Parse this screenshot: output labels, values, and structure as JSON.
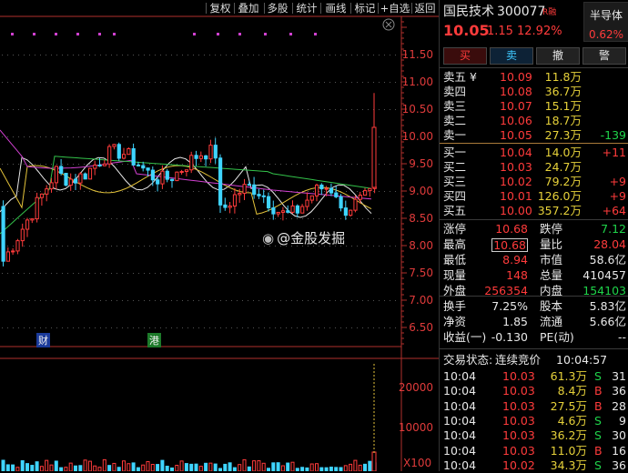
{
  "toolbar": {
    "buttons": [
      "复权",
      "叠加",
      "多股",
      "统计",
      "画线",
      "标记",
      "+自选",
      "返回"
    ]
  },
  "price_axis": [
    "11.50",
    "11.00",
    "10.50",
    "10.00",
    "9.50",
    "9.00",
    "8.50",
    "8.00",
    "7.50",
    "7.00",
    "6.50"
  ],
  "volume_axis": [
    "20000",
    "10000"
  ],
  "volume_unit": "X100",
  "markers": {
    "cai": "财",
    "gang": "港"
  },
  "watermark": "@金股发掘",
  "stock": {
    "name": "国民技术",
    "code": "300077",
    "tag": "R融",
    "sector": "半导体",
    "sector_change": "0.62%",
    "price": "10.05",
    "change": "1.15",
    "change_pct": "12.92%"
  },
  "actions": {
    "buy": "买",
    "sell": "卖",
    "cancel": "撤",
    "alert": "警"
  },
  "asks": [
    {
      "label": "卖五 ¥",
      "price": "10.09",
      "vol": "11.8万",
      "delta": ""
    },
    {
      "label": "卖四",
      "price": "10.08",
      "vol": "36.7万",
      "delta": ""
    },
    {
      "label": "卖三",
      "price": "10.07",
      "vol": "15.1万",
      "delta": ""
    },
    {
      "label": "卖二",
      "price": "10.06",
      "vol": "18.7万",
      "delta": ""
    },
    {
      "label": "卖一",
      "price": "10.05",
      "vol": "27.3万",
      "delta": "-139"
    }
  ],
  "bids": [
    {
      "label": "买一",
      "price": "10.04",
      "vol": "14.0万",
      "delta": "+11"
    },
    {
      "label": "买二",
      "price": "10.03",
      "vol": "24.7万",
      "delta": ""
    },
    {
      "label": "买三",
      "price": "10.02",
      "vol": "79.2万",
      "delta": "+9"
    },
    {
      "label": "买四",
      "price": "10.01",
      "vol": "126.0万",
      "delta": "+9"
    },
    {
      "label": "买五",
      "price": "10.00",
      "vol": "357.2万",
      "delta": "+64"
    }
  ],
  "stats": [
    {
      "l1": "涨停",
      "v1": "10.68",
      "l2": "跌停",
      "v2": "7.12"
    },
    {
      "l1": "最高",
      "v1": "10.68",
      "l2": "量比",
      "v2": "28.04"
    },
    {
      "l1": "最低",
      "v1": "8.94",
      "l2": "市值",
      "v2": "58.6亿"
    },
    {
      "l1": "现量",
      "v1": "148",
      "l2": "总量",
      "v2": "410457"
    },
    {
      "l1": "外盘",
      "v1": "256354",
      "l2": "内盘",
      "v2": "154103"
    }
  ],
  "stats2": [
    {
      "l1": "换手",
      "v1": "7.25%",
      "l2": "股本",
      "v2": "5.83亿"
    },
    {
      "l1": "净资",
      "v1": "1.85",
      "l2": "流通",
      "v2": "5.66亿"
    },
    {
      "l1": "收益(一)",
      "v1": "-0.130",
      "l2": "PE(动)",
      "v2": "--"
    }
  ],
  "trade_status": {
    "label": "交易状态:",
    "value": "连续竞价",
    "time": "10:04:57"
  },
  "ticks": [
    {
      "time": "10:04",
      "price": "10.03",
      "vol": "61.3万",
      "side": "S",
      "n": "31"
    },
    {
      "time": "10:04",
      "price": "10.03",
      "vol": "8.4万",
      "side": "B",
      "n": "36"
    },
    {
      "time": "10:04",
      "price": "10.03",
      "vol": "27.5万",
      "side": "B",
      "n": "28"
    },
    {
      "time": "10:04",
      "price": "10.03",
      "vol": "4.6万",
      "side": "S",
      "n": "9"
    },
    {
      "time": "10:04",
      "price": "10.03",
      "vol": "36.2万",
      "side": "S",
      "n": "30"
    },
    {
      "time": "10:04",
      "price": "10.03",
      "vol": "11.0万",
      "side": "B",
      "n": "16"
    },
    {
      "time": "10:04",
      "price": "10.02",
      "vol": "34.3万",
      "side": "S",
      "n": "36"
    }
  ]
}
